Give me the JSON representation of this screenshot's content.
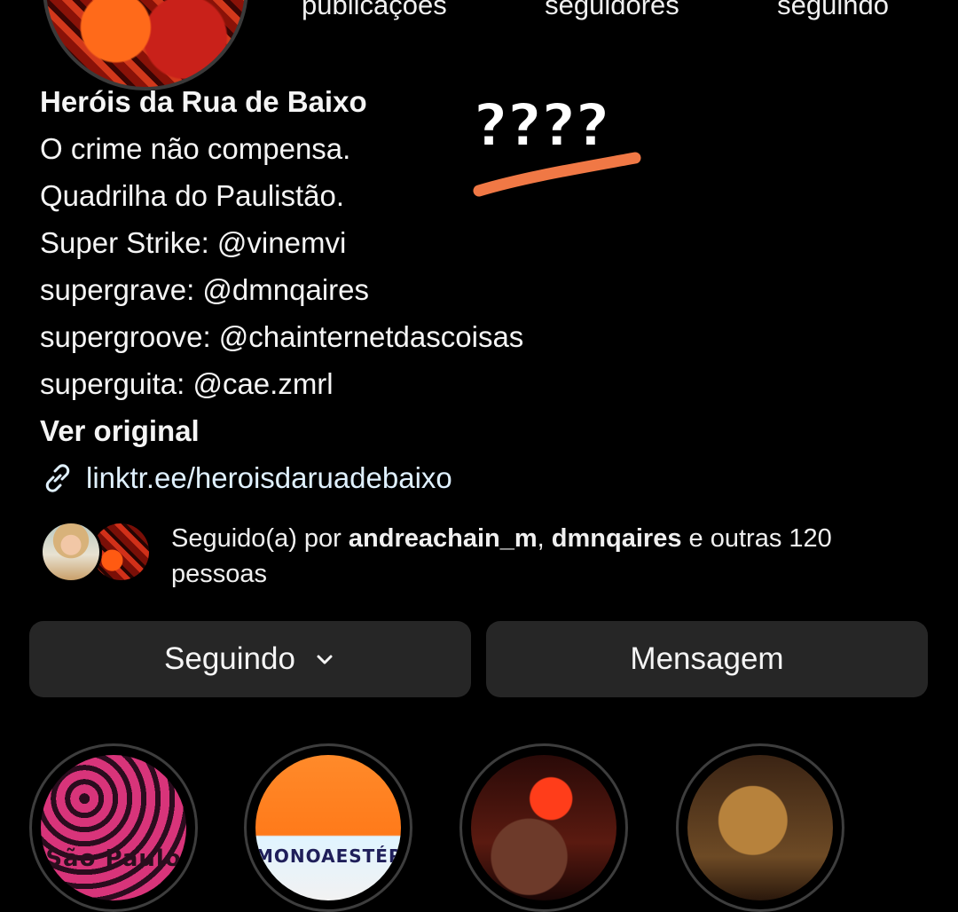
{
  "stats": {
    "posts_label": "publicações",
    "followers_label": "seguidores",
    "following_label": "seguindo"
  },
  "bio": {
    "name": "Heróis da Rua de Baixo",
    "lines": [
      "O crime não compensa.",
      "Quadrilha do Paulistão.",
      "Super Strike: @vinemvi",
      "supergrave: @dmnqaires",
      "supergroove: @chainternetdascoisas",
      "superguita: @cae.zmrl"
    ],
    "ver_original": "Ver original",
    "link": "linktr.ee/heroisdaruadebaixo"
  },
  "annotation": {
    "text": "????",
    "underline_color": "#f07845"
  },
  "followed_by": {
    "prefix": "Seguido(a) por",
    "user1": "andreachain_m",
    "separator": ",",
    "user2": "dmnqaires",
    "suffix": "e outras 120 pessoas"
  },
  "buttons": {
    "following_label": "Seguindo",
    "message_label": "Mensagem"
  },
  "highlights": [
    {
      "cover_text": "São Paulo"
    },
    {
      "cover_text": "MONOAESTÉREO"
    },
    {
      "cover_text": ""
    },
    {
      "cover_text": ""
    }
  ],
  "colors": {
    "background": "#000000",
    "button_bg": "#262626",
    "link": "#e0f1ff"
  }
}
